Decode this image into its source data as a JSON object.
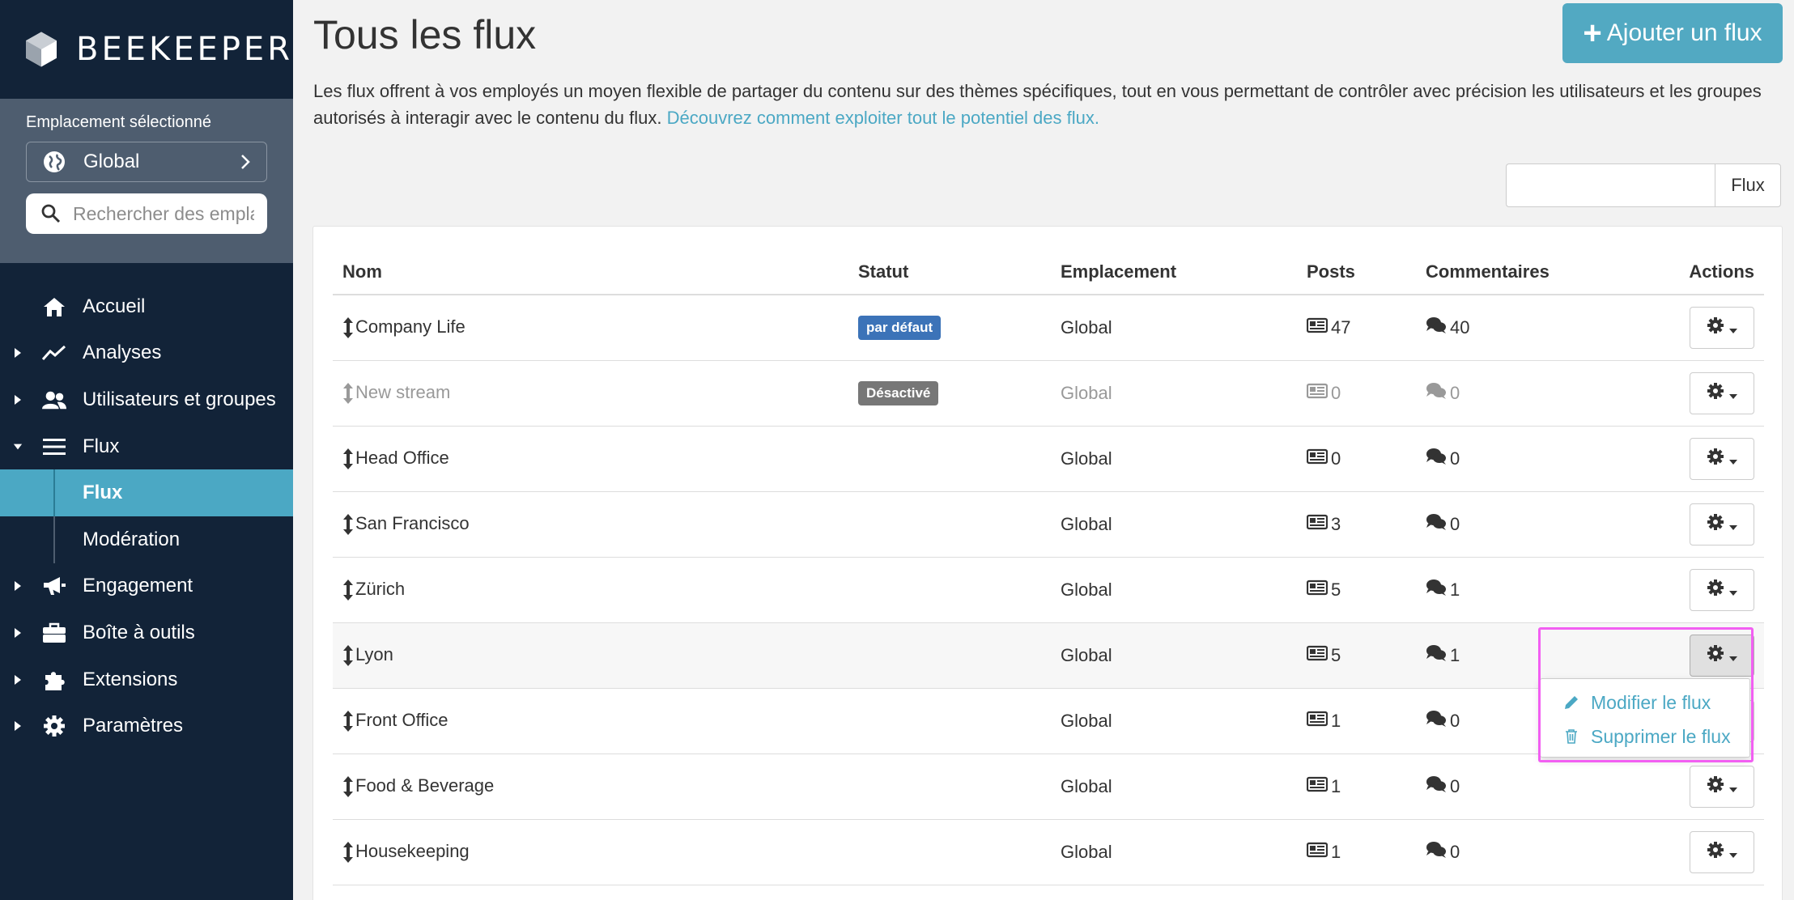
{
  "brand": {
    "name": "BEEKEEPER"
  },
  "location": {
    "label": "Emplacement sélectionné",
    "selected": "Global",
    "search_placeholder": "Rechercher des emplac"
  },
  "nav": {
    "home": "Accueil",
    "analytics": "Analyses",
    "users": "Utilisateurs et groupes",
    "flux": "Flux",
    "flux_sub": "Flux",
    "moderation": "Modération",
    "engagement": "Engagement",
    "toolbox": "Boîte à outils",
    "extensions": "Extensions",
    "settings": "Paramètres"
  },
  "header": {
    "title": "Tous les flux",
    "add_button": "Ajouter un flux",
    "intro": "Les flux offrent à vos employés un moyen flexible de partager du contenu sur des thèmes spécifiques, tout en vous permettant de contrôler avec précision les utilisateurs et les groupes autorisés à interagir avec le contenu du flux.",
    "intro_link": "Découvrez comment exploiter tout le potentiel des flux."
  },
  "filter": {
    "addon": "Flux",
    "value": ""
  },
  "table": {
    "headers": {
      "name": "Nom",
      "status": "Statut",
      "location": "Emplacement",
      "posts": "Posts",
      "comments": "Commentaires",
      "actions": "Actions"
    },
    "rows": [
      {
        "name": "Company Life",
        "status": "par défaut",
        "location": "Global",
        "posts": "47",
        "comments": "40"
      },
      {
        "name": "New stream",
        "status": "Désactivé",
        "location": "Global",
        "posts": "0",
        "comments": "0"
      },
      {
        "name": "Head Office",
        "status": "",
        "location": "Global",
        "posts": "0",
        "comments": "0"
      },
      {
        "name": "San Francisco",
        "status": "",
        "location": "Global",
        "posts": "3",
        "comments": "0"
      },
      {
        "name": "Zürich",
        "status": "",
        "location": "Global",
        "posts": "5",
        "comments": "1"
      },
      {
        "name": "Lyon",
        "status": "",
        "location": "Global",
        "posts": "5",
        "comments": "1"
      },
      {
        "name": "Front Office",
        "status": "",
        "location": "Global",
        "posts": "1",
        "comments": "0"
      },
      {
        "name": "Food & Beverage",
        "status": "",
        "location": "Global",
        "posts": "1",
        "comments": "0"
      },
      {
        "name": "Housekeeping",
        "status": "",
        "location": "Global",
        "posts": "1",
        "comments": "0"
      }
    ]
  },
  "dropdown": {
    "edit": "Modifier le flux",
    "delete": "Supprimer le flux"
  },
  "colors": {
    "sidebar": "#122338",
    "location_panel": "#4e5d6f",
    "accent": "#4ba8c4",
    "default_badge": "#3c73b8",
    "disabled_badge": "#777777",
    "highlight": "#f25ff2"
  }
}
